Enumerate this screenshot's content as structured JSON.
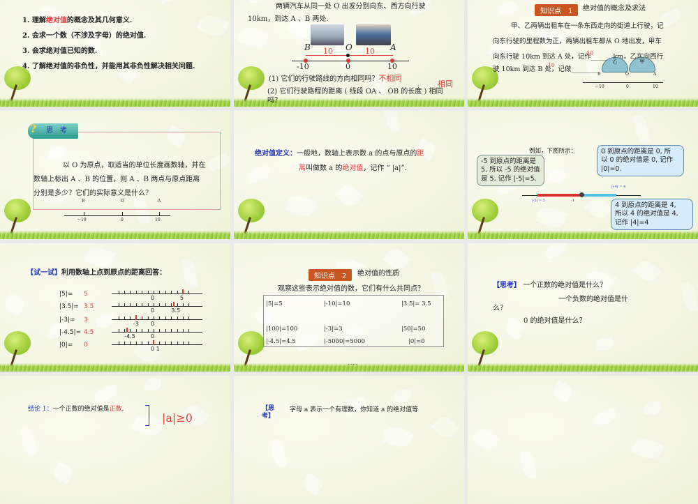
{
  "slide1": {
    "lines": [
      {
        "pre": "1. 理解",
        "hl": "绝对值",
        "post": "的概念及其几何意义."
      },
      {
        "text": "2. 会求一个数（不涉及字母）的绝对值."
      },
      {
        "text": "3. 会求绝对值已知的数."
      },
      {
        "text": "4. 了解绝对值的非负性，并能用其非负性解决相关问题."
      }
    ]
  },
  "slide2": {
    "para1": "两辆汽车从同一处 O 出发分别向东、西方向行驶",
    "para2": "10km，到达 A 、B 两处.",
    "labels": {
      "B": "B",
      "O": "O",
      "A": "A",
      "left_dist": "10",
      "right_dist": "10",
      "tick_neg": "-10",
      "tick_zero": "0",
      "tick_pos": "10"
    },
    "q1": "(1) 它们的行驶路线的方向相同吗？",
    "a1": "不相同",
    "a2": "相同",
    "q2": "(2) 它们行驶路程的距离 ( 线段 OA 、 OB 的长度 ) 相同",
    "q2b": "吗？"
  },
  "slide3": {
    "badge": "知识点　1",
    "title": "绝对值的概念及求法",
    "lines": [
      "甲、乙两辆出租车在一条东西走向的街道上行驶，记",
      "向东行驶的里程数为正，两辆出租车都从 O 地出发，甲车",
      "向东行驶 10km 到达 A 处，记作______ km，乙车向西行",
      "驶 10km 到达 B 处，记做________"
    ],
    "ans1": "10",
    "ans2": "-10",
    "car_left": "乙",
    "car_right": "甲",
    "axis": {
      "B": "B",
      "O": "O",
      "A": "A",
      "neg": "－10",
      "zero": "0",
      "pos": "10"
    }
  },
  "slide4": {
    "badge": "思　考",
    "lines": [
      "以 O 为原点，取适当的单位长度画数轴，并在",
      "数轴上标出 A 、B 的位置，则 A 、B 两点与原点距离",
      "分别是多少？它们的实际意义是什么？"
    ],
    "axis": {
      "B": "B",
      "O": "O",
      "A": "A",
      "neg": "－10",
      "zero": "0",
      "pos": "10"
    }
  },
  "slide5": {
    "label": "绝对值定义：",
    "l1a": "一般地，数轴上表示数 a 的点与原点的",
    "l1b": "距",
    "l2a": "离",
    "l2b": "叫做数 a 的",
    "l2c": "绝对值",
    "l2d": "，记作 “ |a|”."
  },
  "slide6": {
    "intro": "例如，下图所示：",
    "callout_left": [
      "-5 到原点的距离是",
      "5, 所以 -5 的绝对值",
      "是 5, 记作 |-5|=5."
    ],
    "callout_top": [
      "0 到原点的距离是 0, 所",
      "以 0 的绝对值是 0, 记作",
      "|0|=0."
    ],
    "callout_bottom": [
      "4 到原点的距离是 4,",
      "所以 4 的绝对值是 4,",
      "记作 |4|=4"
    ],
    "axis_left_label": "|-5| = 5",
    "axis_right_label": "|+4| = 4",
    "axis_tick": "-1"
  },
  "slide7": {
    "title_bracket": "【试一试】",
    "title": "利用数轴上点到原点的距离回答：",
    "rows": [
      {
        "q": "|5|=",
        "a": "5",
        "marks": [
          "0",
          "5"
        ]
      },
      {
        "q": "|3.5|=",
        "a": "3.5",
        "marks": [
          "0",
          "3.5"
        ]
      },
      {
        "q": "|-3|=",
        "a": "3",
        "marks": [
          "-3",
          "0"
        ]
      },
      {
        "q": "|-4.5|=",
        "a": "4.5",
        "marks": [
          "-4.5",
          "0"
        ]
      },
      {
        "q": "|0|=",
        "a": "0",
        "marks": [
          "0 1"
        ]
      }
    ]
  },
  "slide8": {
    "badge": "知识点　2",
    "title": "绝对值的性质",
    "question": "观察这些表示绝对值的数，它们有什么共同点？",
    "cells": [
      "|5|=5",
      "|-10|=10",
      "|3.5|= 3.5",
      "|100|=100",
      "|-3|=3",
      "|50|=50",
      "|-4.5|=4.5",
      "|-5000|=5000",
      "|0|=0"
    ],
    "dots": "……"
  },
  "slide9": {
    "bracket": "【思考】",
    "l1": "一个正数的绝对值是什么？",
    "l2": "一个负数的绝对值是什",
    "l3": "么？",
    "l4": "0 的绝对值是什么？"
  },
  "slide10": {
    "label": "结论 1：",
    "text": "一个正数的绝对值是",
    "hl": "正数",
    "end": ".",
    "formula": "|a|≥0"
  },
  "slide11": {
    "bracket": "【思考】",
    "text": "字母 a 表示一个有理数，你知道 a 的绝对值等"
  }
}
